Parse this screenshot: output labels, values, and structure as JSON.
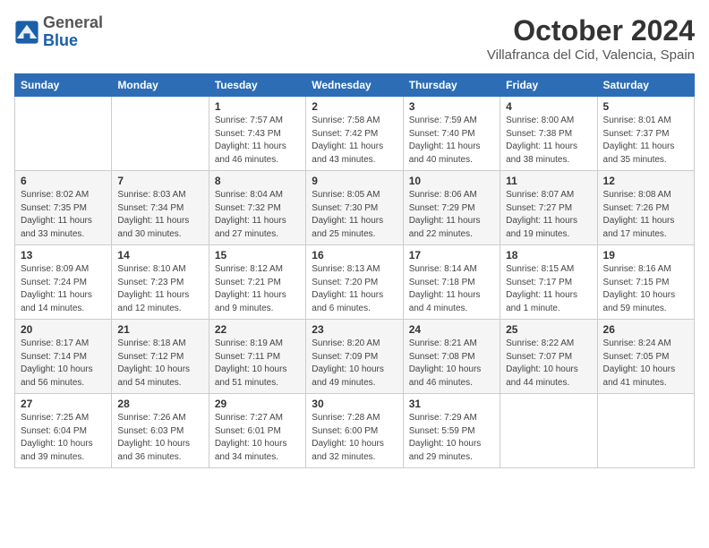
{
  "header": {
    "logo_general": "General",
    "logo_blue": "Blue",
    "month_title": "October 2024",
    "location": "Villafranca del Cid, Valencia, Spain"
  },
  "columns": [
    "Sunday",
    "Monday",
    "Tuesday",
    "Wednesday",
    "Thursday",
    "Friday",
    "Saturday"
  ],
  "weeks": [
    [
      {
        "day": "",
        "info": ""
      },
      {
        "day": "",
        "info": ""
      },
      {
        "day": "1",
        "info": "Sunrise: 7:57 AM\nSunset: 7:43 PM\nDaylight: 11 hours\nand 46 minutes."
      },
      {
        "day": "2",
        "info": "Sunrise: 7:58 AM\nSunset: 7:42 PM\nDaylight: 11 hours\nand 43 minutes."
      },
      {
        "day": "3",
        "info": "Sunrise: 7:59 AM\nSunset: 7:40 PM\nDaylight: 11 hours\nand 40 minutes."
      },
      {
        "day": "4",
        "info": "Sunrise: 8:00 AM\nSunset: 7:38 PM\nDaylight: 11 hours\nand 38 minutes."
      },
      {
        "day": "5",
        "info": "Sunrise: 8:01 AM\nSunset: 7:37 PM\nDaylight: 11 hours\nand 35 minutes."
      }
    ],
    [
      {
        "day": "6",
        "info": "Sunrise: 8:02 AM\nSunset: 7:35 PM\nDaylight: 11 hours\nand 33 minutes."
      },
      {
        "day": "7",
        "info": "Sunrise: 8:03 AM\nSunset: 7:34 PM\nDaylight: 11 hours\nand 30 minutes."
      },
      {
        "day": "8",
        "info": "Sunrise: 8:04 AM\nSunset: 7:32 PM\nDaylight: 11 hours\nand 27 minutes."
      },
      {
        "day": "9",
        "info": "Sunrise: 8:05 AM\nSunset: 7:30 PM\nDaylight: 11 hours\nand 25 minutes."
      },
      {
        "day": "10",
        "info": "Sunrise: 8:06 AM\nSunset: 7:29 PM\nDaylight: 11 hours\nand 22 minutes."
      },
      {
        "day": "11",
        "info": "Sunrise: 8:07 AM\nSunset: 7:27 PM\nDaylight: 11 hours\nand 19 minutes."
      },
      {
        "day": "12",
        "info": "Sunrise: 8:08 AM\nSunset: 7:26 PM\nDaylight: 11 hours\nand 17 minutes."
      }
    ],
    [
      {
        "day": "13",
        "info": "Sunrise: 8:09 AM\nSunset: 7:24 PM\nDaylight: 11 hours\nand 14 minutes."
      },
      {
        "day": "14",
        "info": "Sunrise: 8:10 AM\nSunset: 7:23 PM\nDaylight: 11 hours\nand 12 minutes."
      },
      {
        "day": "15",
        "info": "Sunrise: 8:12 AM\nSunset: 7:21 PM\nDaylight: 11 hours\nand 9 minutes."
      },
      {
        "day": "16",
        "info": "Sunrise: 8:13 AM\nSunset: 7:20 PM\nDaylight: 11 hours\nand 6 minutes."
      },
      {
        "day": "17",
        "info": "Sunrise: 8:14 AM\nSunset: 7:18 PM\nDaylight: 11 hours\nand 4 minutes."
      },
      {
        "day": "18",
        "info": "Sunrise: 8:15 AM\nSunset: 7:17 PM\nDaylight: 11 hours\nand 1 minute."
      },
      {
        "day": "19",
        "info": "Sunrise: 8:16 AM\nSunset: 7:15 PM\nDaylight: 10 hours\nand 59 minutes."
      }
    ],
    [
      {
        "day": "20",
        "info": "Sunrise: 8:17 AM\nSunset: 7:14 PM\nDaylight: 10 hours\nand 56 minutes."
      },
      {
        "day": "21",
        "info": "Sunrise: 8:18 AM\nSunset: 7:12 PM\nDaylight: 10 hours\nand 54 minutes."
      },
      {
        "day": "22",
        "info": "Sunrise: 8:19 AM\nSunset: 7:11 PM\nDaylight: 10 hours\nand 51 minutes."
      },
      {
        "day": "23",
        "info": "Sunrise: 8:20 AM\nSunset: 7:09 PM\nDaylight: 10 hours\nand 49 minutes."
      },
      {
        "day": "24",
        "info": "Sunrise: 8:21 AM\nSunset: 7:08 PM\nDaylight: 10 hours\nand 46 minutes."
      },
      {
        "day": "25",
        "info": "Sunrise: 8:22 AM\nSunset: 7:07 PM\nDaylight: 10 hours\nand 44 minutes."
      },
      {
        "day": "26",
        "info": "Sunrise: 8:24 AM\nSunset: 7:05 PM\nDaylight: 10 hours\nand 41 minutes."
      }
    ],
    [
      {
        "day": "27",
        "info": "Sunrise: 7:25 AM\nSunset: 6:04 PM\nDaylight: 10 hours\nand 39 minutes."
      },
      {
        "day": "28",
        "info": "Sunrise: 7:26 AM\nSunset: 6:03 PM\nDaylight: 10 hours\nand 36 minutes."
      },
      {
        "day": "29",
        "info": "Sunrise: 7:27 AM\nSunset: 6:01 PM\nDaylight: 10 hours\nand 34 minutes."
      },
      {
        "day": "30",
        "info": "Sunrise: 7:28 AM\nSunset: 6:00 PM\nDaylight: 10 hours\nand 32 minutes."
      },
      {
        "day": "31",
        "info": "Sunrise: 7:29 AM\nSunset: 5:59 PM\nDaylight: 10 hours\nand 29 minutes."
      },
      {
        "day": "",
        "info": ""
      },
      {
        "day": "",
        "info": ""
      }
    ]
  ]
}
